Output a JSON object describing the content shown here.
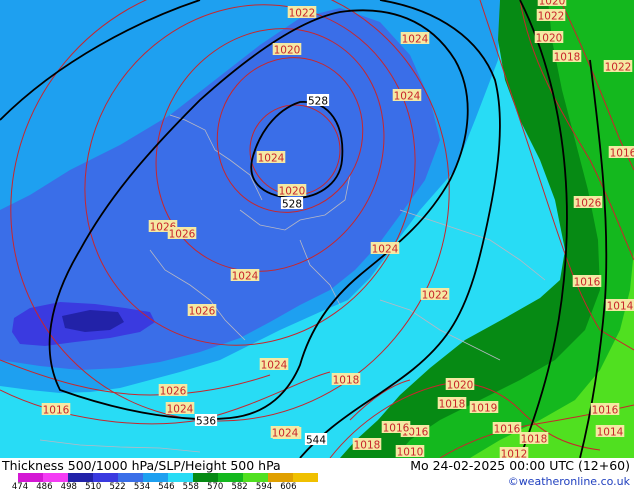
{
  "map": {
    "colors": {
      "c474": "#d418d4",
      "c486": "#f43cf4",
      "c498": "#2222a8",
      "c510": "#3a3ae0",
      "c522": "#3a6ee8",
      "c534": "#1ea0f0",
      "c546": "#28dcf5",
      "c558": "#068a14",
      "c570": "#14b81e",
      "c582": "#50e020",
      "isobar": "#c8262c",
      "height": "#000000",
      "border": "#b8b8c4"
    },
    "pressure_labels": [
      "1022",
      "1022",
      "1024",
      "1020",
      "1018",
      "1020",
      "1024",
      "1020",
      "1022",
      "1016",
      "1026",
      "1026",
      "1024",
      "1024",
      "1026",
      "1024",
      "1022",
      "1016",
      "1014",
      "1018",
      "1024",
      "1026",
      "1020",
      "1026",
      "1024",
      "1018",
      "1019",
      "1016",
      "1016",
      "1016",
      "1014",
      "1016",
      "1018",
      "1022",
      "1020",
      "1018",
      "1016",
      "1010",
      "1012",
      "1024"
    ],
    "height_labels": [
      "528",
      "528",
      "536",
      "544"
    ]
  },
  "footer": {
    "title": "Thickness 500/1000 hPa/SLP/Height 500 hPa",
    "valid_time": "Mo 24-02-2025 00:00 UTC (12+60)",
    "credit": "©weatheronline.co.uk",
    "legend_values": [
      "474",
      "486",
      "498",
      "510",
      "522",
      "534",
      "546",
      "558",
      "570",
      "582",
      "594",
      "606"
    ],
    "legend_colors": [
      "#d418d4",
      "#f43cf4",
      "#2222a8",
      "#3a3ae0",
      "#3a6ee8",
      "#1ea0f0",
      "#28dcf5",
      "#068a14",
      "#14b81e",
      "#50e020",
      "#e0a000",
      "#f0c000"
    ]
  }
}
